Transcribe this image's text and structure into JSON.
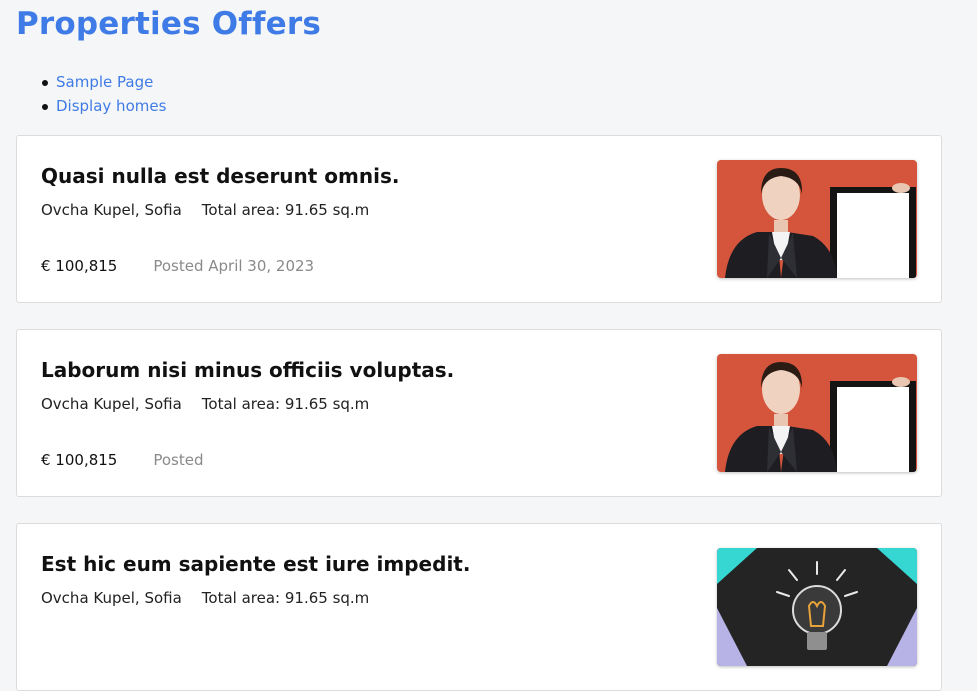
{
  "page": {
    "title": "Properties Offers"
  },
  "breadcrumbs": [
    {
      "label": "Sample Page"
    },
    {
      "label": "Display homes"
    }
  ],
  "listings": [
    {
      "title": "Quasi nulla est deserunt omnis.",
      "location": "Ovcha Kupel, Sofia",
      "area": "Total area: 91.65 sq.m",
      "price": "€ 100,815",
      "posted": "Posted April 30, 2023",
      "image": "businesswoman-holding-blank-board"
    },
    {
      "title": "Laborum nisi minus officiis voluptas.",
      "location": "Ovcha Kupel, Sofia",
      "area": "Total area: 91.65 sq.m",
      "price": "€ 100,815",
      "posted": "Posted",
      "image": "businesswoman-holding-blank-board"
    },
    {
      "title": "Est hic eum sapiente est iure impedit.",
      "location": "Ovcha Kupel, Sofia",
      "area": "Total area: 91.65 sq.m",
      "price": "",
      "posted": "",
      "image": "light-bulb-idea"
    }
  ]
}
